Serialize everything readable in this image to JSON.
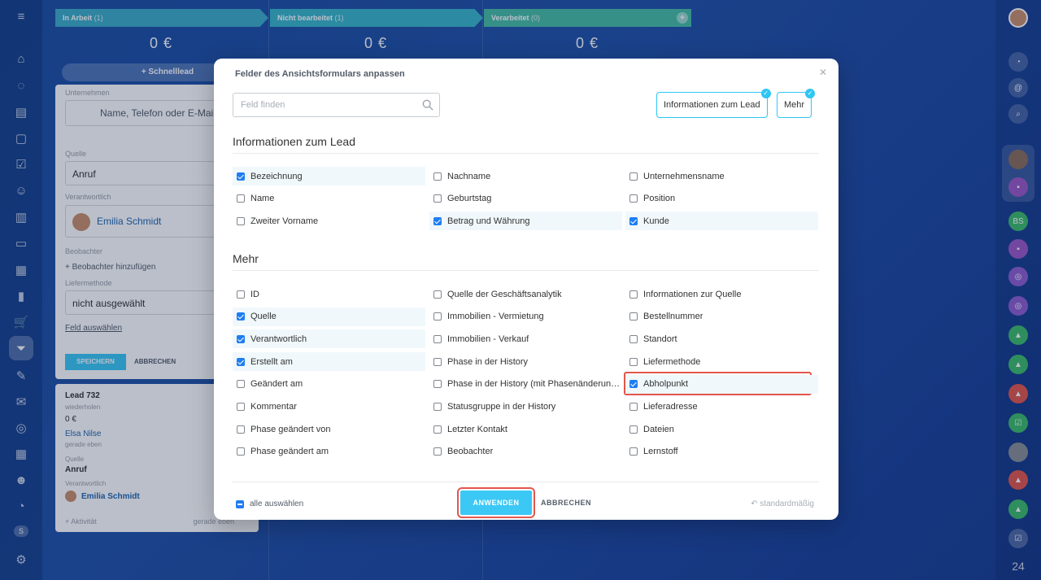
{
  "stages": [
    {
      "name": "In Arbeit",
      "count": "(1)",
      "sum": "0 €",
      "color": "#3cadc8"
    },
    {
      "name": "Nicht bearbeitet",
      "count": "(1)",
      "sum": "0 €",
      "color": "#39b7c9"
    },
    {
      "name": "Verarbeitet",
      "count": "(0)",
      "sum": "0 €",
      "color": "#47bea5"
    }
  ],
  "quick_lead": "+ Schnelllead",
  "card_edit": {
    "company_label": "Unternehmen",
    "company_placeholder": "Name, Telefon oder E-Mail",
    "source_label": "Quelle",
    "source_value": "Anruf",
    "responsible_label": "Verantwortlich",
    "responsible_name": "Emilia Schmidt",
    "observer_label": "Beobachter",
    "observer_add": "+ Beobachter hinzufügen",
    "delivery_label": "Liefermethode",
    "delivery_value": "nicht ausgewählt",
    "select_field": "Feld auswählen",
    "save": "SPEICHERN",
    "cancel": "ABBRECHEN"
  },
  "card_lead": {
    "title": "Lead 732",
    "repeat": "wiederholen",
    "amount": "0 €",
    "client": "Elsa Nilse",
    "time": "gerade eben",
    "source_label": "Quelle",
    "source_value": "Anruf",
    "responsible_label": "Verantwortlich",
    "responsible_name": "Emilia Schmidt",
    "activity": "+ Aktivität",
    "activity_time": "gerade eben"
  },
  "modal": {
    "title": "Felder des Ansichtsformulars anpassen",
    "search_placeholder": "Feld finden",
    "chips": [
      "Informationen zum Lead",
      "Mehr"
    ],
    "section1_title": "Informationen zum Lead",
    "section2_title": "Mehr",
    "section1_fields": [
      {
        "label": "Bezeichnung",
        "checked": true
      },
      {
        "label": "Nachname",
        "checked": false
      },
      {
        "label": "Unternehmensname",
        "checked": false
      },
      {
        "label": "Name",
        "checked": false
      },
      {
        "label": "Geburtstag",
        "checked": false
      },
      {
        "label": "Position",
        "checked": false
      },
      {
        "label": "Zweiter Vorname",
        "checked": false
      },
      {
        "label": "Betrag und Währung",
        "checked": true
      },
      {
        "label": "Kunde",
        "checked": true
      }
    ],
    "section2_fields": [
      {
        "label": "ID",
        "checked": false
      },
      {
        "label": "Quelle der Geschäftsanalytik",
        "checked": false
      },
      {
        "label": "Informationen zur Quelle",
        "checked": false
      },
      {
        "label": "Quelle",
        "checked": true
      },
      {
        "label": "Immobilien - Vermietung",
        "checked": false
      },
      {
        "label": "Bestellnummer",
        "checked": false
      },
      {
        "label": "Verantwortlich",
        "checked": true
      },
      {
        "label": "Immobilien - Verkauf",
        "checked": false
      },
      {
        "label": "Standort",
        "checked": false
      },
      {
        "label": "Erstellt am",
        "checked": true
      },
      {
        "label": "Phase in der History",
        "checked": false
      },
      {
        "label": "Liefermethode",
        "checked": false
      },
      {
        "label": "Geändert am",
        "checked": false
      },
      {
        "label": "Phase in der History (mit Phasenänderungen)",
        "checked": false
      },
      {
        "label": "Abholpunkt",
        "checked": true
      },
      {
        "label": "Kommentar",
        "checked": false
      },
      {
        "label": "Statusgruppe in der History",
        "checked": false
      },
      {
        "label": "Lieferadresse",
        "checked": false
      },
      {
        "label": "Phase geändert von",
        "checked": false
      },
      {
        "label": "Letzter Kontakt",
        "checked": false
      },
      {
        "label": "Dateien",
        "checked": false
      },
      {
        "label": "Phase geändert am",
        "checked": false
      },
      {
        "label": "Beobachter",
        "checked": false
      },
      {
        "label": "Lernstoff",
        "checked": false
      }
    ],
    "select_all": "alle auswählen",
    "apply": "ANWENDEN",
    "cancel": "ABBRECHEN",
    "default": "standardmäßig"
  },
  "right_rail_badge": "24",
  "right_rail_initials": "BS",
  "left_rail_badge": "S"
}
